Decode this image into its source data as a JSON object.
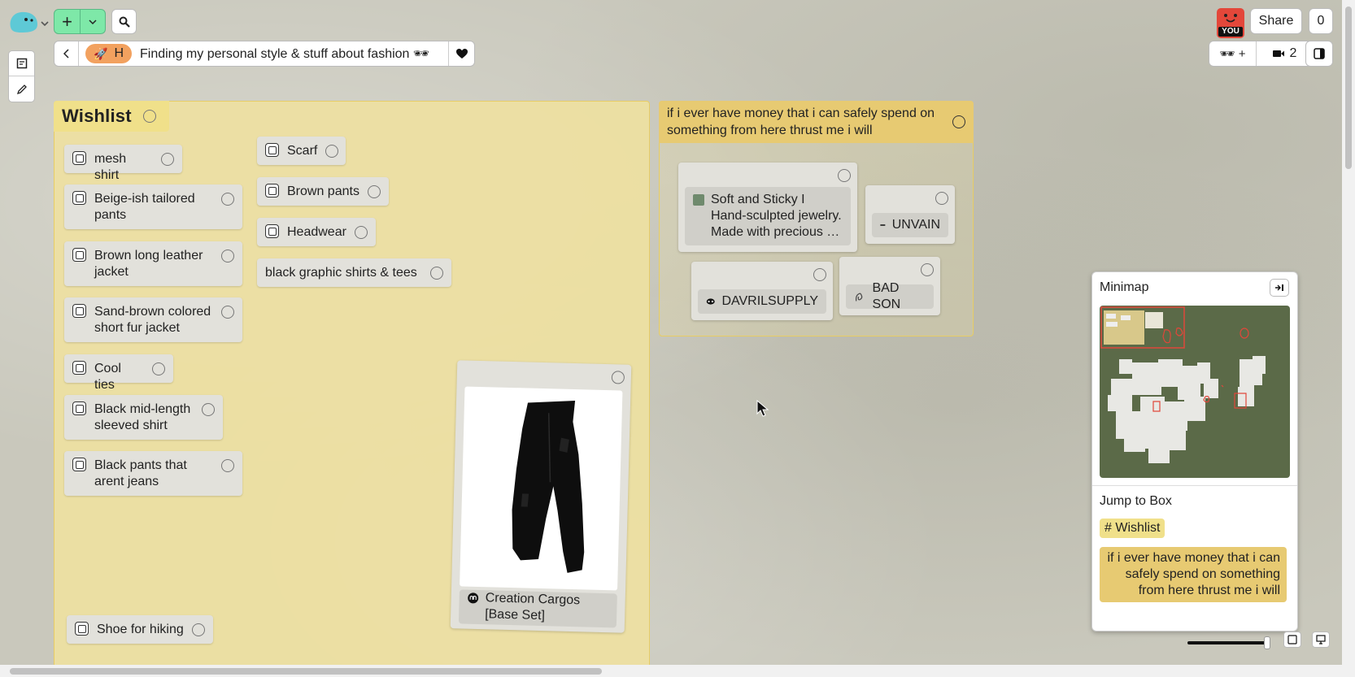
{
  "header": {
    "breadcrumb_emoji": "🚀",
    "breadcrumb_initial": "H",
    "board_title": "Finding my personal style & stuff about fashion 🕶",
    "share_label": "Share",
    "share_count": "0",
    "you_label": "YOU",
    "viewers_label": "🕶 +",
    "video_count": "2"
  },
  "wishlist": {
    "title": "Wishlist",
    "items": [
      {
        "label": "mesh shirt"
      },
      {
        "label": "Beige-ish tailored pants"
      },
      {
        "label": "Brown long leather jacket"
      },
      {
        "label": "Sand-brown colored short fur jacket"
      },
      {
        "label": "Cool ties"
      },
      {
        "label": "Black mid-length sleeved shirt"
      },
      {
        "label": "Black pants that arent jeans"
      },
      {
        "label": "Scarf"
      },
      {
        "label": "Brown pants"
      },
      {
        "label": "Headwear"
      },
      {
        "label": "black graphic shirts & tees"
      },
      {
        "label": "Shoe for hiking"
      }
    ],
    "product": {
      "title": "Creation Cargos [Base Set]"
    }
  },
  "money_box": {
    "title": "if i ever have money that i can safely spend on something from here thrust me i will",
    "links": [
      {
        "label": "Soft and Sticky I Hand-sculpted jewelry. Made with precious …"
      },
      {
        "label": "UNVAIN"
      },
      {
        "label": "DAVRILSUPPLY"
      },
      {
        "label": "BAD SON"
      }
    ]
  },
  "minimap": {
    "title": "Minimap",
    "jump_label": "Jump to Box",
    "boxes": [
      {
        "label": "# Wishlist"
      },
      {
        "label": "if i ever have money that i can safely spend on something from here thrust me i will"
      }
    ],
    "zoom_level": 0.95
  },
  "colors": {
    "yellow_box": "#ede0a3",
    "yellow_header": "#f0e08a",
    "money_header": "#e7ca72",
    "minimap_bg": "#5b6a48",
    "add_button": "#7ee8a8"
  }
}
